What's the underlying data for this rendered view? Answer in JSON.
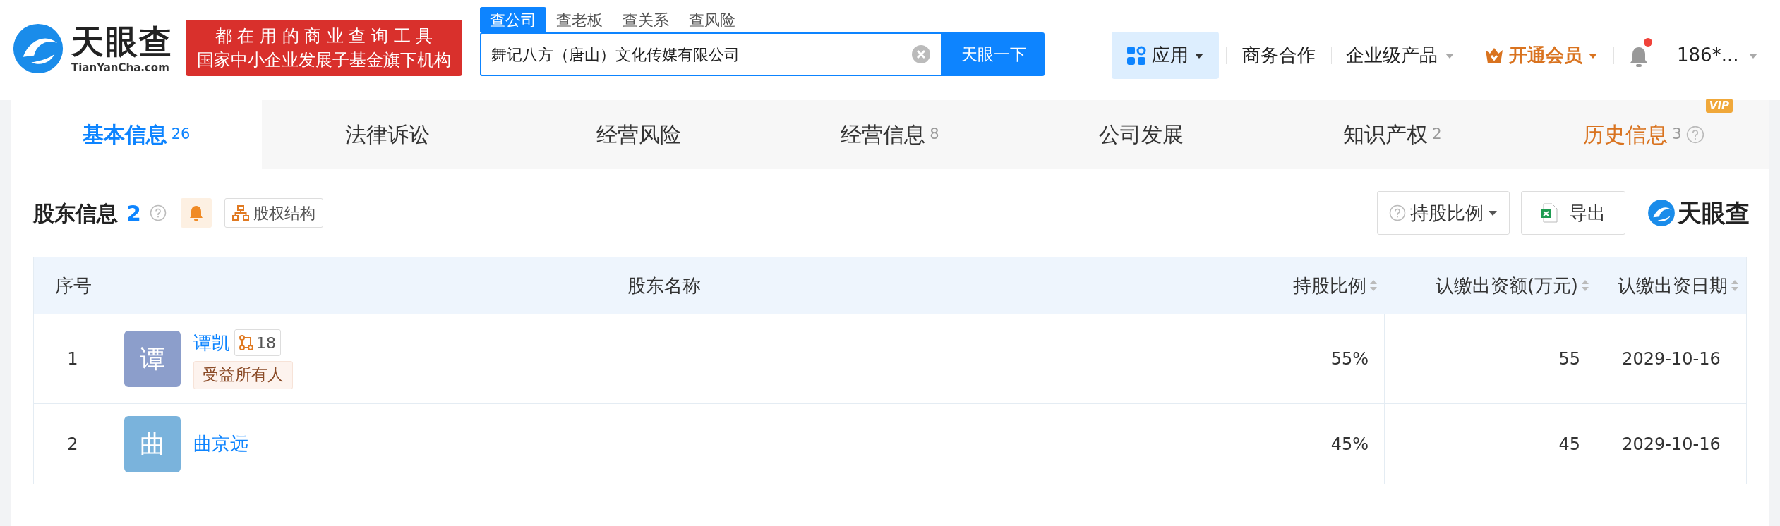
{
  "header": {
    "logo": {
      "name": "天眼查",
      "domain": "TianYanCha.com"
    },
    "banner": [
      "都 在 用 的 商 业 查 询 工 具",
      "国家中小企业发展子基金旗下机构"
    ],
    "search_tabs": [
      {
        "label": "查公司",
        "selected": true
      },
      {
        "label": "查老板",
        "selected": false
      },
      {
        "label": "查关系",
        "selected": false
      },
      {
        "label": "查风险",
        "selected": false
      }
    ],
    "search": {
      "value": "舞记八方（唐山）文化传媒有限公司",
      "button": "天眼一下"
    },
    "nav": [
      {
        "kind": "apps",
        "label": "应用"
      },
      {
        "kind": "link",
        "label": "商务合作"
      },
      {
        "kind": "dropdown",
        "label": "企业级产品"
      },
      {
        "kind": "vip",
        "label": "开通会员"
      },
      {
        "kind": "bell",
        "unread": true
      },
      {
        "kind": "user",
        "label": "186*..."
      }
    ]
  },
  "tabs": [
    {
      "label": "基本信息",
      "count": "26",
      "selected": true
    },
    {
      "label": "法律诉讼",
      "selected": false
    },
    {
      "label": "经营风险",
      "selected": false
    },
    {
      "label": "经营信息",
      "count": "8",
      "selected": false
    },
    {
      "label": "公司发展",
      "selected": false
    },
    {
      "label": "知识产权",
      "count": "2",
      "selected": false
    },
    {
      "label": "历史信息",
      "count": "3",
      "selected": false,
      "vip": "VIP",
      "help": true
    }
  ],
  "section": {
    "title": "股东信息",
    "count": "2",
    "structure_button": "股权结构",
    "ratio_button": "持股比例",
    "export_button": "导出",
    "watermark_logo": "天眼查"
  },
  "table": {
    "columns": [
      {
        "label": "序号",
        "sortable": false
      },
      {
        "label": "股东名称",
        "sortable": false
      },
      {
        "label": "持股比例",
        "sortable": true
      },
      {
        "label": "认缴出资额(万元)",
        "sortable": true
      },
      {
        "label": "认缴出资日期",
        "sortable": true
      }
    ],
    "rows": [
      {
        "index": "1",
        "avatar": "谭",
        "color": "#8c9ecb",
        "name": "谭凯",
        "related": "18",
        "tag": "受益所有人",
        "ratio": "55%",
        "amount": "55",
        "date": "2029-10-16"
      },
      {
        "index": "2",
        "avatar": "曲",
        "color": "#7ab3dc",
        "name": "曲京远",
        "ratio": "45%",
        "amount": "45",
        "date": "2029-10-16"
      }
    ]
  }
}
